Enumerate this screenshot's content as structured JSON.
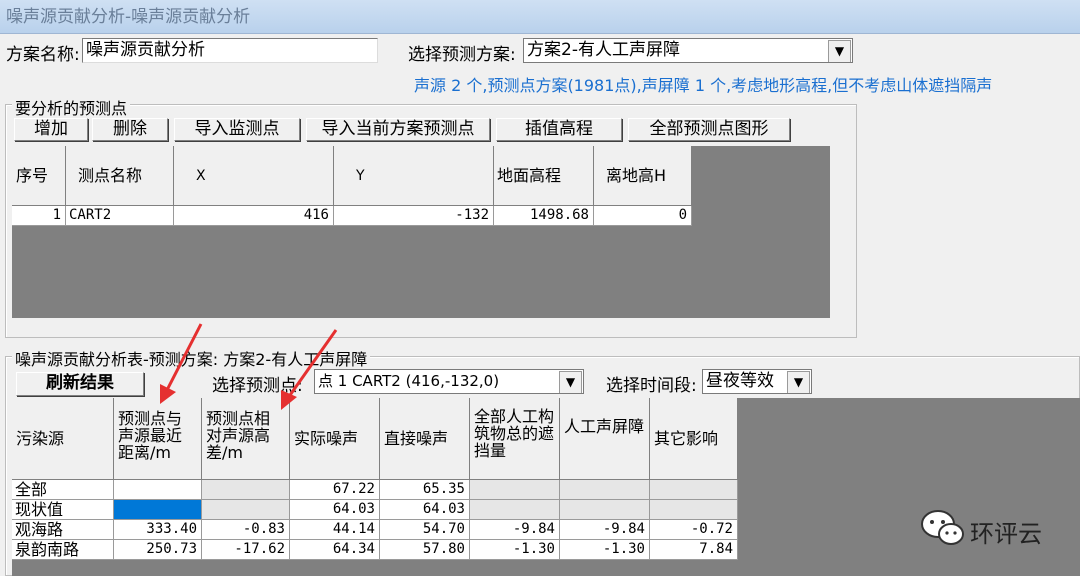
{
  "window": {
    "title": "噪声源贡献分析-噪声源贡献分析"
  },
  "scheme": {
    "name_label": "方案名称:",
    "name_value": "噪声源贡献分析",
    "select_label": "选择预测方案:",
    "select_value": "方案2-有人工声屏障"
  },
  "info_text": "声源 2 个,预测点方案(1981点),声屏障 1 个,考虑地形高程,但不考虑山体遮挡隔声",
  "points_group": {
    "title": "要分析的预测点",
    "buttons": [
      "增加",
      "删除",
      "导入监测点",
      "导入当前方案预测点",
      "插值高程",
      "全部预测点图形"
    ],
    "columns": [
      "序号",
      "测点名称",
      "X",
      "Y",
      "地面高程",
      "离地高H"
    ],
    "rows": [
      [
        "1",
        "CART2",
        "416",
        "-132",
        "1498.68",
        "0"
      ]
    ]
  },
  "analysis_group": {
    "title": "噪声源贡献分析表-预测方案: 方案2-有人工声屏障",
    "refresh_label": "刷新结果",
    "point_label": "选择预测点:",
    "point_value": "点 1 CART2 (416,-132,0)",
    "period_label": "选择时间段:",
    "period_value": "昼夜等效",
    "columns": [
      "污染源",
      "预测点与声源最近距离/m",
      "预测点相对声源高差/m",
      "实际噪声",
      "直接噪声",
      "全部人工构筑物总的遮挡量",
      "人工声屏障",
      "其它影响"
    ],
    "rows": [
      [
        "全部",
        "",
        "",
        "67.22",
        "65.35",
        "",
        "",
        ""
      ],
      [
        "现状值",
        "",
        "",
        "64.03",
        "64.03",
        "",
        "",
        ""
      ],
      [
        "观海路",
        "333.40",
        "-0.83",
        "44.14",
        "54.70",
        "-9.84",
        "-9.84",
        "-0.72"
      ],
      [
        "泉韵南路",
        "250.73",
        "-17.62",
        "64.34",
        "57.80",
        "-1.30",
        "-1.30",
        "7.84"
      ]
    ]
  },
  "watermark": {
    "text": "环评云"
  },
  "colors": {
    "info": "#1a6fd0",
    "arrow": "#e53030",
    "selection": "#0078d7"
  }
}
